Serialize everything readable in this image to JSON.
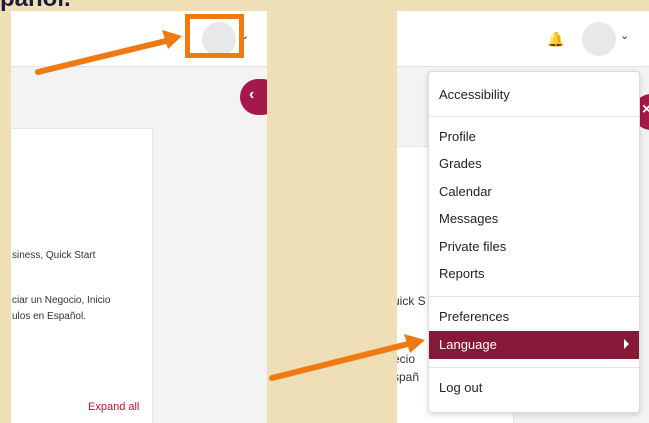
{
  "heading_fragment": "pañol.",
  "left": {
    "card_lines": [
      "siness, Quick Start",
      "ciar un Negocio, Inicio",
      "ulos en Español."
    ],
    "expand_all": "Expand all"
  },
  "right": {
    "bell_icon": "bell-icon",
    "bg_fragments": [
      "uick S",
      "ecio",
      "spañ"
    ],
    "menu": {
      "items": [
        "Accessibility",
        "Profile",
        "Grades",
        "Calendar",
        "Messages",
        "Private files",
        "Reports",
        "Preferences",
        "Language",
        "Log out"
      ]
    }
  },
  "colors": {
    "accent": "#f07a12",
    "brand": "#a5194a",
    "active_menu": "#861937",
    "link": "#c8102e",
    "background": "#eedfb6"
  }
}
